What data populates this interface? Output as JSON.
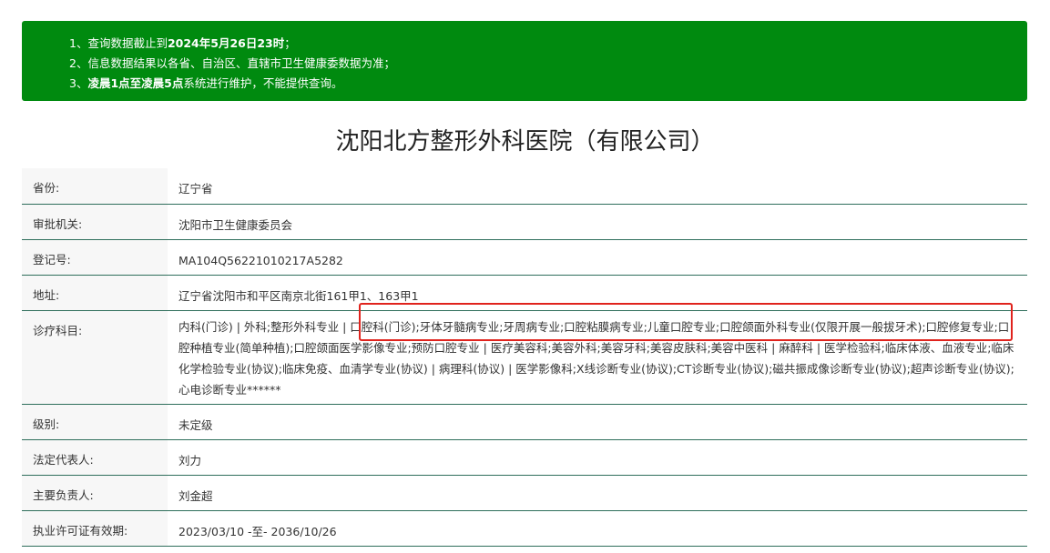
{
  "notice": {
    "line1_prefix": "1、查询数据截止到",
    "line1_bold": "2024年5月26日23时",
    "line1_suffix": "；",
    "line2": "2、信息数据结果以各省、自治区、直辖市卫生健康委数据为准；",
    "line3_prefix": "3、",
    "line3_bold": "凌晨1点至凌晨5点",
    "line3_suffix": "系统进行维护，不能提供查询。"
  },
  "title": "沈阳北方整形外科医院（有限公司）",
  "rows": [
    {
      "label": "省份:",
      "value": "辽宁省"
    },
    {
      "label": "审批机关:",
      "value": "沈阳市卫生健康委员会"
    },
    {
      "label": "登记号:",
      "value": "MA104Q56221010217A5282"
    },
    {
      "label": "地址:",
      "value": "辽宁省沈阳市和平区南京北街161甲1、163甲1"
    },
    {
      "label": "诊疗科目:",
      "value": "内科(门诊) | 外科;整形外科专业 | 口腔科(门诊);牙体牙髓病专业;牙周病专业;口腔粘膜病专业;儿童口腔专业;口腔颌面外科专业(仅限开展一般拔牙术);口腔修复专业;口腔种植专业(简单种植);口腔颌面医学影像专业;预防口腔专业 | 医疗美容科;美容外科;美容牙科;美容皮肤科;美容中医科 | 麻醉科 | 医学检验科;临床体液、血液专业;临床化学检验专业(协议);临床免疫、血清学专业(协议) | 病理科(协议) | 医学影像科;X线诊断专业(协议);CT诊断专业(协议);磁共振成像诊断专业(协议);超声诊断专业(协议);心电诊断专业******"
    },
    {
      "label": "级别:",
      "value": "未定级"
    },
    {
      "label": "法定代表人:",
      "value": "刘力"
    },
    {
      "label": "主要负责人:",
      "value": "刘金超"
    },
    {
      "label": "执业许可证有效期:",
      "value": "2023/03/10 -至- 2036/10/26"
    }
  ],
  "colors": {
    "notice_bg": "#008a0f",
    "row_border": "#2e6e5b",
    "highlight": "#e0231d"
  }
}
